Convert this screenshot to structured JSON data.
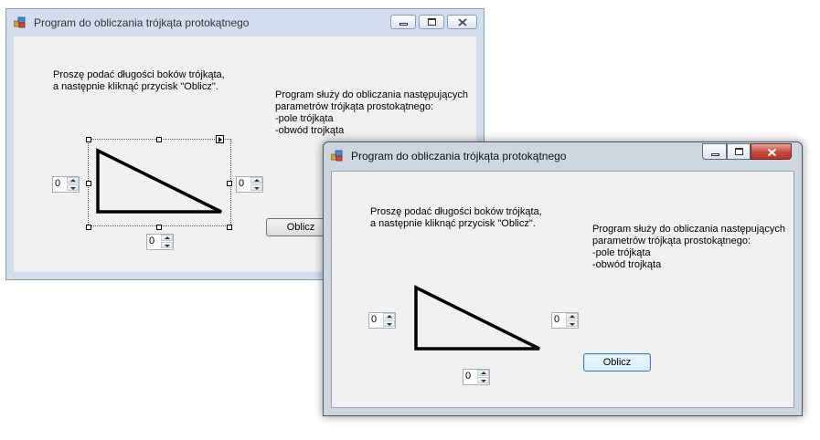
{
  "designer_window": {
    "title": "Program do obliczania trójkąta protokątnego",
    "instruction": "Proszę podać długości boków trójkąta,\na następnie kliknąć przycisk \"Oblicz\".",
    "description": "Program służy do obliczania następujących\nparametrów trójkąta prostokątnego:\n-pole trójkąta\n-obwód trojkąta",
    "side_a": "0",
    "side_b": "0",
    "side_c": "0",
    "button_label": "Oblicz"
  },
  "running_window": {
    "title": "Program do obliczania trójkąta protokątnego",
    "instruction": "Proszę podać długości boków trójkąta,\na następnie kliknąć przycisk \"Oblicz\".",
    "description": "Program służy do obliczania następujących\nparametrów trójkąta prostokątnego:\n-pole trójkąta\n-obwód trojkąta",
    "side_a": "0",
    "side_b": "0",
    "side_c": "0",
    "button_label": "Oblicz"
  },
  "icons": {
    "app": "app-icon",
    "minimize": "minimize-icon",
    "maximize": "maximize-icon",
    "close": "close-icon",
    "spin_up": "spin-up-icon",
    "spin_down": "spin-down-icon"
  },
  "colors": {
    "close_button": "#c9483c",
    "window_frame_active": "#cdd5df",
    "window_frame_inactive": "#d2deee",
    "focus_button": "#3c7fb1"
  }
}
